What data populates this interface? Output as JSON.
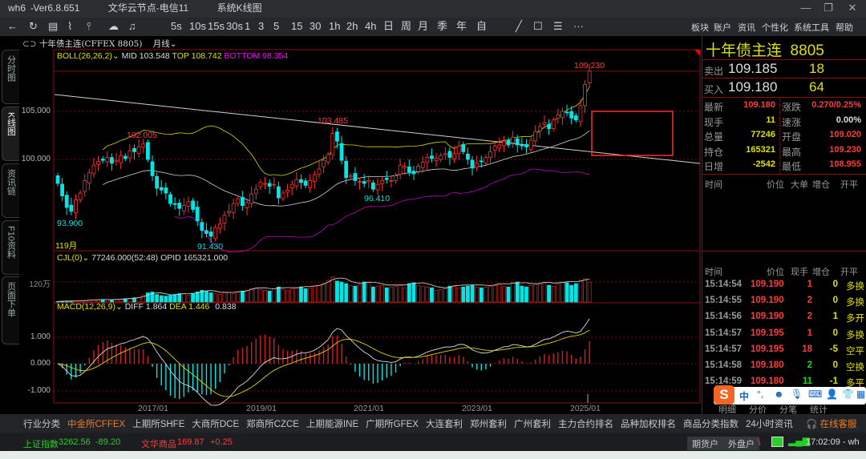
{
  "window": {
    "app": "wh6",
    "version": "Ver6.8.651",
    "server": "文华云节点-电信11",
    "view": "系统K线图"
  },
  "toolbar": {
    "periods": [
      "5s",
      "10s",
      "15s",
      "30s",
      "1",
      "3",
      "5",
      "15",
      "30",
      "1h",
      "2h",
      "4h",
      "日",
      "周",
      "月",
      "季",
      "年",
      "自"
    ],
    "menus": [
      "板块",
      "账户",
      "资讯",
      "个性化",
      "系统工具",
      "帮助"
    ]
  },
  "left_tabs": [
    "分时图",
    "K线图",
    "资讯链",
    "F10资料",
    "页面下单"
  ],
  "chart": {
    "symbol": "十年债主连(CFFEX 8805)",
    "period": "月线",
    "boll": {
      "label": "BOLL(26,26,2)",
      "mid": "MID 103.548",
      "top": "TOP 108.742",
      "bottom": "BOTTOM 98.354"
    },
    "price_ticks": [
      "105.000",
      "100.000"
    ],
    "bar_count": "119月",
    "annotations": {
      "high": "109.230",
      "p1": "102.005",
      "p2": "103.485",
      "l1": "96.410",
      "l2": "93.900",
      "l3": "91.430"
    },
    "vol": {
      "label": "CJL(0)",
      "value": "77246.000(52:48)",
      "opid": "OPID 165321.000",
      "tick": "120万"
    },
    "macd": {
      "label": "MACD(12,26,9)",
      "diff": "DIFF 1.864",
      "dea": "DEA 1.446",
      "macd": "0.838",
      "ticks": [
        "1.000",
        "0.000",
        "-1.000"
      ]
    },
    "dates": [
      "2017/01",
      "2019/01",
      "2021/01",
      "2023/01",
      "2025/01"
    ],
    "colors": {
      "up": "#ff3030",
      "down": "#00e5e5",
      "mid": "#d8d800",
      "top": "#d8d8d8",
      "bottom": "#c000c0"
    }
  },
  "chart_data": {
    "type": "candlestick",
    "start": "2015/03",
    "interval": "month",
    "close": [
      97.5,
      96.2,
      95.0,
      94.6,
      95.8,
      96.5,
      97.8,
      98.6,
      99.4,
      99.8,
      99.9,
      100.2,
      99.6,
      99.9,
      100.4,
      100.1,
      100.9,
      100.8,
      101.3,
      101.6,
      100.0,
      98.3,
      97.0,
      96.8,
      96.5,
      95.4,
      95.3,
      94.9,
      95.2,
      95.6,
      94.8,
      93.6,
      92.6,
      92.3,
      92.0,
      92.9,
      93.3,
      94.2,
      94.6,
      95.4,
      95.9,
      95.2,
      95.5,
      96.4,
      96.9,
      97.6,
      97.5,
      97.2,
      97.4,
      96.0,
      96.5,
      96.8,
      97.4,
      97.9,
      97.6,
      97.3,
      97.8,
      98.4,
      99.0,
      99.9,
      100.5,
      102.7,
      101.9,
      99.9,
      98.1,
      98.3,
      97.8,
      97.7,
      97.5,
      97.8,
      96.9,
      97.4,
      97.8,
      97.9,
      97.8,
      98.3,
      99.4,
      99.3,
      98.7,
      98.5,
      99.3,
      99.7,
      100.2,
      100.1,
      100.1,
      100.4,
      100.6,
      100.2,
      100.6,
      101.4,
      100.8,
      100.0,
      99.1,
      99.6,
      99.8,
      100.2,
      100.8,
      101.4,
      101.5,
      101.9,
      101.5,
      102.3,
      101.5,
      101.4,
      101.3,
      102.0,
      102.9,
      103.4,
      103.8,
      103.2,
      104.1,
      104.6,
      105.0,
      104.9,
      104.3,
      104.1,
      105.6,
      107.8,
      109.18
    ],
    "volume_wan": [
      3,
      5,
      6,
      6,
      7,
      8,
      10,
      12,
      14,
      13,
      15,
      13,
      12,
      16,
      18,
      20,
      22,
      25,
      28,
      40,
      55,
      60,
      45,
      38,
      35,
      40,
      45,
      50,
      48,
      42,
      50,
      60,
      70,
      65,
      55,
      50,
      45,
      60,
      55,
      50,
      60,
      65,
      70,
      80,
      85,
      75,
      70,
      65,
      80,
      90,
      75,
      70,
      80,
      85,
      90,
      80,
      85,
      95,
      100,
      110,
      130,
      150,
      125,
      120,
      110,
      100,
      95,
      105,
      120,
      115,
      90,
      95,
      100,
      85,
      90,
      95,
      100,
      85,
      110,
      115,
      100,
      95,
      90,
      85,
      70,
      75,
      80,
      95,
      100,
      85,
      90,
      95,
      100,
      90,
      85,
      90,
      95,
      100,
      110,
      95,
      90,
      115,
      120,
      95,
      90,
      100,
      110,
      105,
      115,
      100,
      95,
      110,
      120,
      115,
      100,
      110,
      130,
      140,
      120
    ]
  },
  "quote": {
    "title": "十年债主连  8805",
    "ask_label": "卖出",
    "ask": "109.185",
    "ask_vol": "18",
    "bid_label": "买入",
    "bid": "109.180",
    "bid_vol": "64",
    "stats": [
      {
        "l": "最新",
        "v": "109.180",
        "l2": "涨跌",
        "v2": "0.270/0.25%"
      },
      {
        "l": "现手",
        "v": "11",
        "l2": "速涨",
        "v2": "0.00%"
      },
      {
        "l": "总量",
        "v": "77246",
        "l2": "开盘",
        "v2": "109.020"
      },
      {
        "l": "持仓",
        "v": "165321",
        "l2": "最高",
        "v2": "109.230"
      },
      {
        "l": "日增",
        "v": "-2542",
        "l2": "最低",
        "v2": "108.955"
      }
    ],
    "big_header": [
      "时间",
      "价位",
      "大单",
      "增仓",
      "开平"
    ],
    "tick_header": [
      "时间",
      "价位",
      "现手",
      "增仓",
      "开平"
    ],
    "ticks": [
      [
        "15:14:54",
        "109.190",
        "1",
        "0",
        "多换"
      ],
      [
        "15:14:55",
        "109.190",
        "2",
        "0",
        "多换"
      ],
      [
        "15:14:56",
        "109.190",
        "2",
        "1",
        "多开"
      ],
      [
        "15:14:57",
        "109.195",
        "1",
        "0",
        "多换"
      ],
      [
        "15:14:57",
        "109.195",
        "18",
        "-5",
        "空平"
      ],
      [
        "15:14:58",
        "109.180",
        "2",
        "0",
        "空换"
      ],
      [
        "15:14:59",
        "109.180",
        "11",
        "-1",
        "多平"
      ]
    ],
    "tabs": [
      "明细",
      "分价",
      "分笔",
      "统计"
    ]
  },
  "ime": {
    "label": "中"
  },
  "bottom_tabs": [
    "行业分类",
    "中金所CFFEX",
    "上期所SHFE",
    "大商所DCE",
    "郑商所CZCE",
    "上期能源INE",
    "广期所GFEX",
    "大连套利",
    "郑州套利",
    "广州套利",
    "主力合约排名",
    "品种加权排名",
    "商品分类指数",
    "24小时资讯"
  ],
  "service": "在线客服",
  "status": {
    "idx1_name": "上证指数",
    "idx1_val": "3262.56",
    "idx1_chg": "-89.20",
    "idx2_name": "文华商品",
    "idx2_val": "169.87",
    "idx2_chg": "+0.25",
    "btn1": "期货户",
    "btn2": "外盘户",
    "time": "17:02:09 - wh"
  }
}
